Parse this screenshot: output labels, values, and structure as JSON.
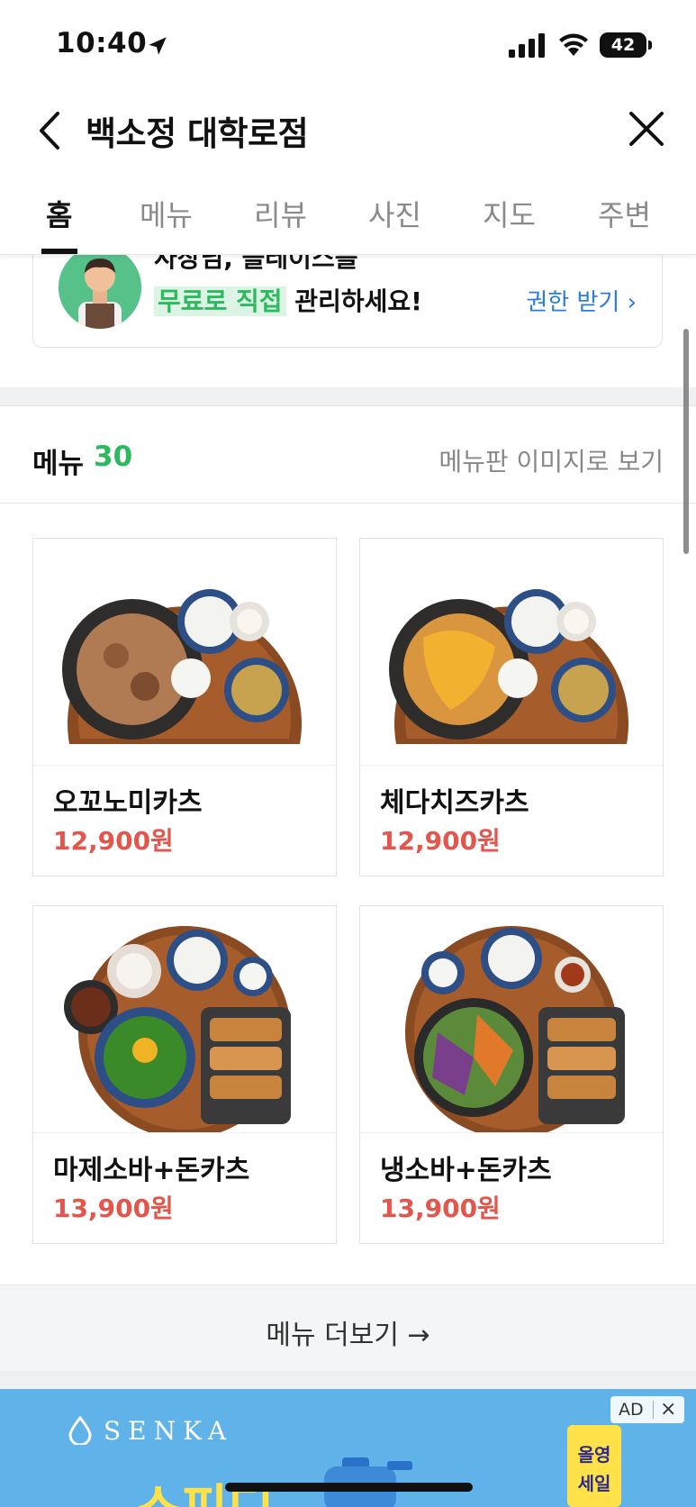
{
  "status_bar": {
    "time": "10:40",
    "battery": "42"
  },
  "header": {
    "title": "백소정 대학로점"
  },
  "tabs": [
    {
      "label": "홈",
      "active": true
    },
    {
      "label": "메뉴",
      "active": false
    },
    {
      "label": "리뷰",
      "active": false
    },
    {
      "label": "사진",
      "active": false
    },
    {
      "label": "지도",
      "active": false
    },
    {
      "label": "주변",
      "active": false
    }
  ],
  "owner_banner": {
    "line1": "사장님, 플레이스를",
    "highlight": "무료로 직접",
    "rest": " 관리하세요!",
    "link": "권한 받기 ›"
  },
  "menu": {
    "title": "메뉴",
    "count": "30",
    "image_link": "메뉴판 이미지로 보기",
    "items": [
      {
        "name": "오꼬노미카츠",
        "price": "12,900원"
      },
      {
        "name": "체다치즈카츠",
        "price": "12,900원"
      },
      {
        "name": "마제소바+돈카츠",
        "price": "13,900원"
      },
      {
        "name": "냉소바+돈카츠",
        "price": "13,900원"
      }
    ],
    "more_label": "메뉴 더보기 →"
  },
  "ad": {
    "brand": "SENKA",
    "badge": "AD",
    "headline": "스피디",
    "sale_text": "올영세일"
  },
  "colors": {
    "accent_green": "#2db95f",
    "price_red": "#e4564b",
    "link_blue": "#2b7ce0",
    "ad_blue": "#5fb3e8"
  }
}
